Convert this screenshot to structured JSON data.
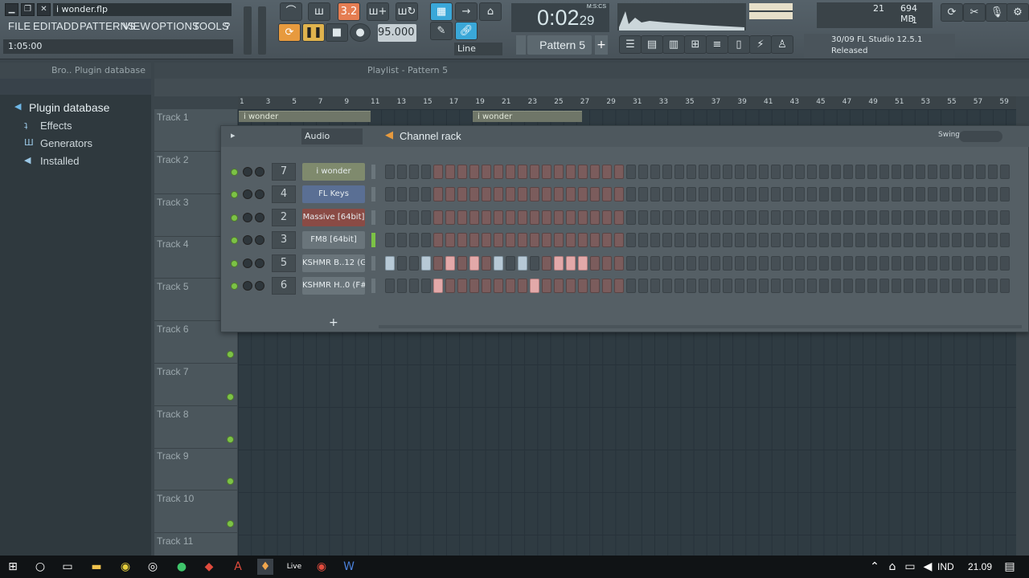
{
  "window": {
    "filename": "i wonder.flp",
    "hint": "1:05:00"
  },
  "menu": [
    "FILE",
    "EDIT",
    "ADD",
    "PATTERNS",
    "VIEW",
    "OPTIONS",
    "TOOLS",
    "?"
  ],
  "transport": {
    "tempo": "95.000",
    "time_main": "0:02",
    "time_sub": "29",
    "time_label": "M:S:CS",
    "snap": "Line",
    "pattern": "Pattern 5",
    "mem": "694 MB",
    "cpu": "21",
    "poly": "1"
  },
  "hint_panel": {
    "line1": "30/09  FL Studio 12.5.1",
    "line2": "Released"
  },
  "browser": {
    "title": "Bro.. Plugin database",
    "root": "Plugin database",
    "items": [
      "Effects",
      "Generators",
      "Installed"
    ]
  },
  "playlist": {
    "title": "Playlist - Pattern 5",
    "timeline": [
      "1",
      "3",
      "5",
      "7",
      "9",
      "11",
      "13",
      "15",
      "17",
      "19",
      "21",
      "23",
      "25",
      "27",
      "29",
      "31",
      "33",
      "35",
      "37",
      "39",
      "41",
      "43",
      "45",
      "47",
      "49",
      "51",
      "53",
      "55",
      "57",
      "59"
    ],
    "tracks": [
      "Track 1",
      "Track 2",
      "Track 3",
      "Track 4",
      "Track 5",
      "Track 6",
      "Track 7",
      "Track 8",
      "Track 9",
      "Track 10",
      "Track 11"
    ],
    "clips": [
      "i wonder",
      "i wonder"
    ]
  },
  "channel_rack": {
    "title": "Channel rack",
    "group": "Audio",
    "swing": "Swing",
    "channels": [
      {
        "num": "7",
        "name": "i wonder",
        "color": "#7f8a6d"
      },
      {
        "num": "4",
        "name": "FL Keys",
        "color": "#5a6f94"
      },
      {
        "num": "2",
        "name": "Massive [64bit]",
        "color": "#8a4b45"
      },
      {
        "num": "3",
        "name": "FM8 [64bit]",
        "color": "#6a757b"
      },
      {
        "num": "5",
        "name": "KSHMR B..12 (G)",
        "color": "#6a757b"
      },
      {
        "num": "6",
        "name": "KSHMR H..0 (F#)",
        "color": "#6a757b"
      }
    ]
  },
  "taskbar": {
    "lang": "IND",
    "clock": "21.09"
  }
}
